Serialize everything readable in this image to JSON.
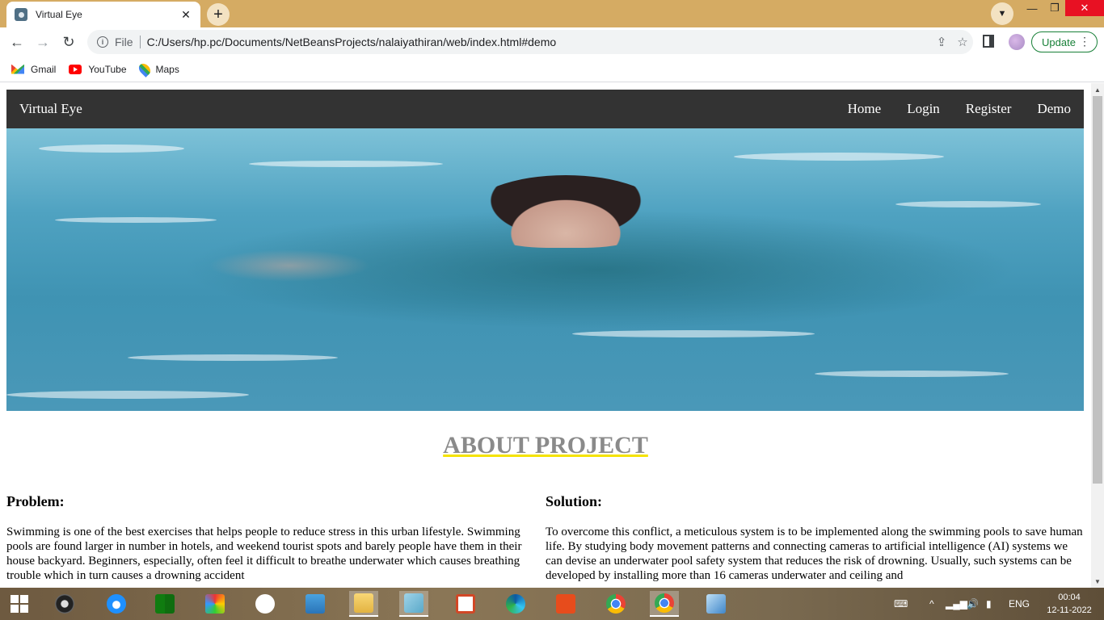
{
  "browser": {
    "tab_title": "Virtual Eye",
    "tab_close": "✕",
    "new_tab": "+",
    "scheme": "File",
    "url": "C:/Users/hp.pc/Documents/NetBeansProjects/nalaiyathiran/web/index.html#demo",
    "update_label": "Update",
    "bookmarks": [
      {
        "label": "Gmail",
        "icon": "gmail-icon"
      },
      {
        "label": "YouTube",
        "icon": "youtube-icon"
      },
      {
        "label": "Maps",
        "icon": "maps-icon"
      }
    ]
  },
  "site": {
    "brand": "Virtual Eye",
    "nav": [
      "Home",
      "Login",
      "Register",
      "Demo"
    ],
    "about_title": "ABOUT PROJECT",
    "problem": {
      "heading": "Problem:",
      "text": "Swimming is one of the best exercises that helps people to reduce stress in this urban lifestyle. Swimming pools are found larger in number in hotels, and weekend tourist spots and barely people have them in their house backyard. Beginners, especially, often feel it difficult to breathe underwater which causes breathing trouble which in turn causes a drowning accident"
    },
    "solution": {
      "heading": "Solution:",
      "text": "To overcome this conflict, a meticulous system is to be implemented along the swimming pools to save human life. By studying body movement patterns and connecting cameras to artificial intelligence (AI) systems we can devise an underwater pool safety system that reduces the risk of drowning. Usually, such systems can be developed by installing more than 16 cameras underwater and ceiling and"
    }
  },
  "taskbar": {
    "language": "ENG",
    "time": "00:04",
    "date": "12-11-2022"
  },
  "colors": {
    "titlebar": "#d5ab63",
    "site_nav": "#333333",
    "about_title": "#8a8a8a",
    "underline": "#f5e300",
    "update_green": "#188038"
  }
}
